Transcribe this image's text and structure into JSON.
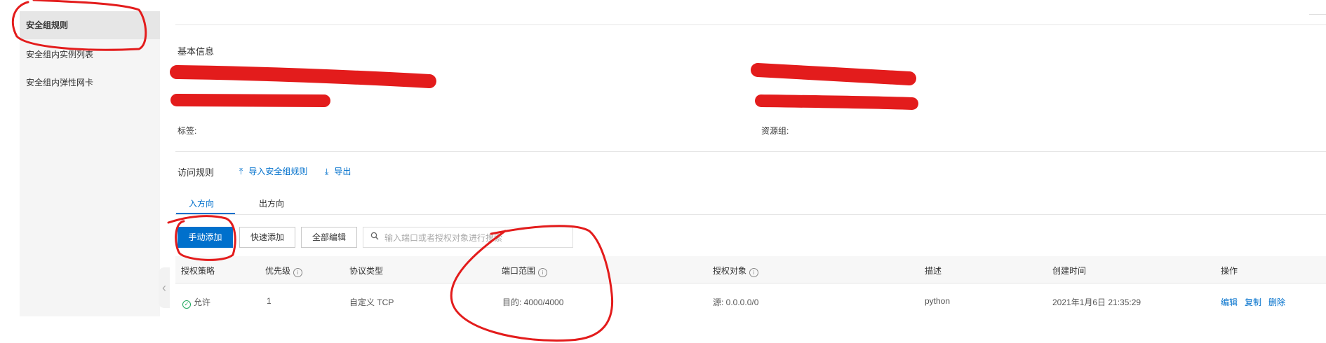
{
  "sidebar": {
    "items": [
      {
        "label": "安全组规则",
        "active": true
      },
      {
        "label": "安全组内实例列表",
        "active": false
      },
      {
        "label": "安全组内弹性网卡",
        "active": false
      }
    ]
  },
  "basic_info": {
    "title": "基本信息",
    "tags_label": "标签:",
    "resource_group_label": "资源组:"
  },
  "rules": {
    "title": "访问规则",
    "import_label": "导入安全组规则",
    "export_label": "导出"
  },
  "tabs": [
    {
      "label": "入方向",
      "active": true
    },
    {
      "label": "出方向",
      "active": false
    }
  ],
  "toolbar": {
    "manual_add": "手动添加",
    "quick_add": "快速添加",
    "edit_all": "全部编辑",
    "search_placeholder": "输入端口或者授权对象进行搜索"
  },
  "table": {
    "headers": [
      "授权策略",
      "优先级",
      "协议类型",
      "端口范围",
      "授权对象",
      "描述",
      "创建时间",
      "操作"
    ],
    "rows": [
      {
        "policy": "允许",
        "priority": "1",
        "protocol": "自定义 TCP",
        "port": "目的: 4000/4000",
        "source": "源: 0.0.0.0/0",
        "description": "python",
        "created": "2021年1月6日 21:35:29",
        "actions": [
          "编辑",
          "复制",
          "删除"
        ]
      }
    ]
  },
  "colors": {
    "primary": "#0070cc",
    "annotation": "#e31c1c",
    "allow": "#1ea85c"
  }
}
